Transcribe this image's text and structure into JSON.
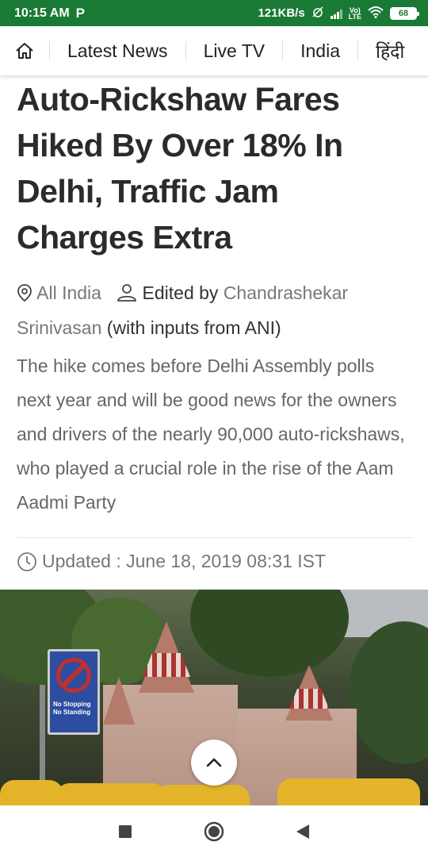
{
  "status_bar": {
    "time": "10:15 AM",
    "app_icon": "P",
    "network_speed": "121KB/s",
    "volte_top": "Vo)",
    "volte_bottom": "LTE",
    "battery": "68"
  },
  "nav": {
    "home_icon": "home-icon",
    "items": [
      {
        "label": "Latest News"
      },
      {
        "label": "Live TV"
      },
      {
        "label": "India"
      },
      {
        "label": "हिंदी"
      }
    ]
  },
  "article": {
    "headline": "Auto-Rickshaw Fares Hiked By Over 18% In Delhi, Traffic Jam Charges Extra",
    "location": "All India",
    "edited_by_label": "Edited by",
    "editor": "Chandrashekar Srinivasan",
    "editor_suffix": "(with inputs from ANI)",
    "summary": "The hike comes before Delhi Assembly polls next year and will be good news for the owners and drivers of the nearly 90,000 auto-rickshaws, who played a crucial role in the rise of the Aam Aadmi Party",
    "updated": "Updated : June 18, 2019 08:31 IST"
  },
  "hero_image": {
    "sign_line1": "No Stopping",
    "sign_line2": "No Standing"
  },
  "colors": {
    "status_bar": "#1a7a35",
    "headline": "#2b2b2b",
    "muted": "#777777"
  }
}
